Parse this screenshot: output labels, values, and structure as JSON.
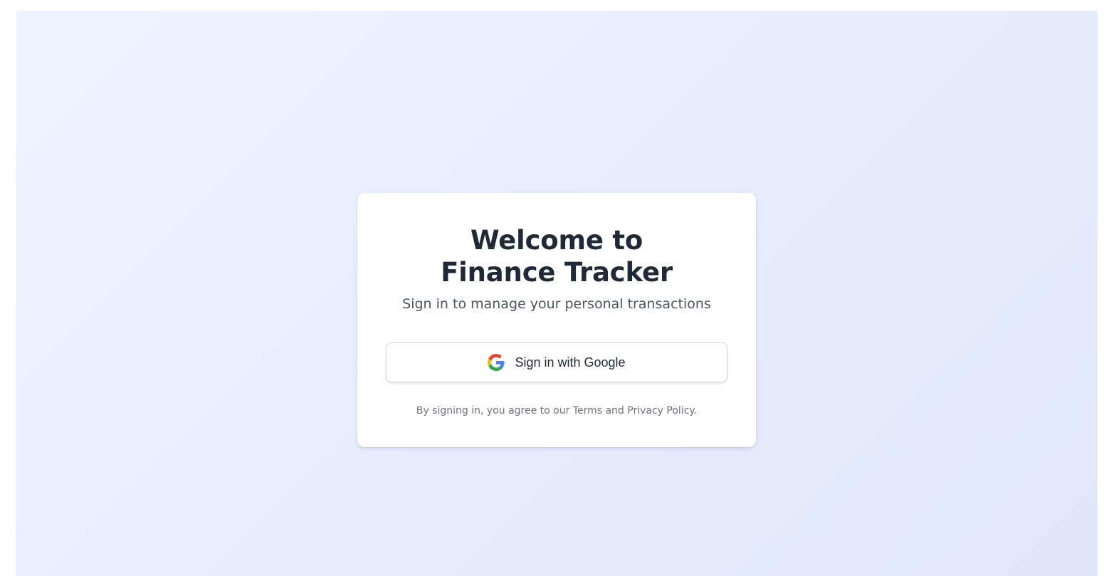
{
  "login": {
    "title": "Welcome to Finance Tracker",
    "subtitle": "Sign in to manage your personal transactions",
    "google_button_label": "Sign in with Google",
    "google_icon": "google-g-icon",
    "legal_text": "By signing in, you agree to our Terms and Privacy Policy."
  },
  "colors": {
    "background_start": "#eef4ff",
    "background_end": "#e1e6fb",
    "card": "#ffffff",
    "title": "#1f2937",
    "subtitle": "#4b5563",
    "legal": "#6b7280"
  }
}
